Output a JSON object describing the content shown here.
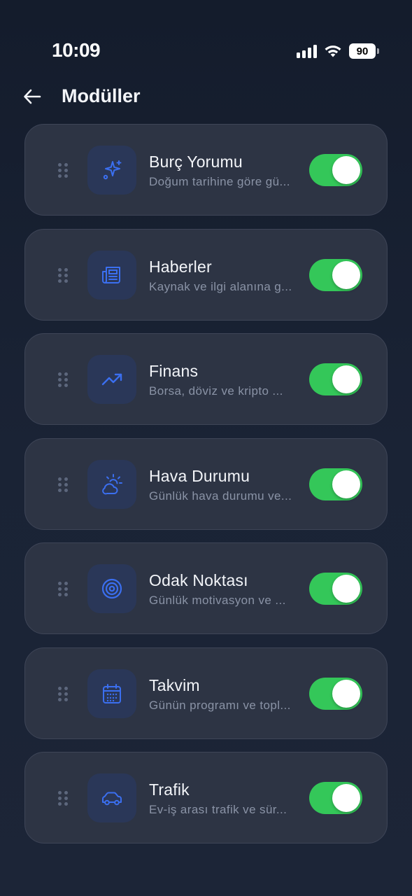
{
  "status_bar": {
    "time": "10:09",
    "battery": "90",
    "icons": [
      "cellular-signal-icon",
      "wifi-icon",
      "battery-icon"
    ]
  },
  "header": {
    "back_icon": "arrow-left-icon",
    "title": "Modüller"
  },
  "colors": {
    "background": "#161e2f",
    "card": "#2d3444",
    "card_border": "#3e4557",
    "icon_tile": "#2a3758",
    "accent_blue": "#3b6ff0",
    "toggle_on": "#34c759",
    "secondary_text": "#8a93a6"
  },
  "modules": [
    {
      "title": "Burç Yorumu",
      "description": "Doğum tarihine göre gü...",
      "icon": "sparkles-icon",
      "enabled": true
    },
    {
      "title": "Haberler",
      "description": "Kaynak ve ilgi alanına g...",
      "icon": "newspaper-icon",
      "enabled": true
    },
    {
      "title": "Finans",
      "description": "Borsa, döviz ve kripto ...",
      "icon": "trending-up-icon",
      "enabled": true
    },
    {
      "title": "Hava Durumu",
      "description": "Günlük hava durumu ve...",
      "icon": "cloud-sun-icon",
      "enabled": true
    },
    {
      "title": "Odak Noktası",
      "description": "Günlük motivasyon ve ...",
      "icon": "target-icon",
      "enabled": true
    },
    {
      "title": "Takvim",
      "description": "Günün programı ve topl...",
      "icon": "calendar-icon",
      "enabled": true
    },
    {
      "title": "Trafik",
      "description": "Ev-iş arası trafik ve sür...",
      "icon": "car-icon",
      "enabled": true
    }
  ]
}
